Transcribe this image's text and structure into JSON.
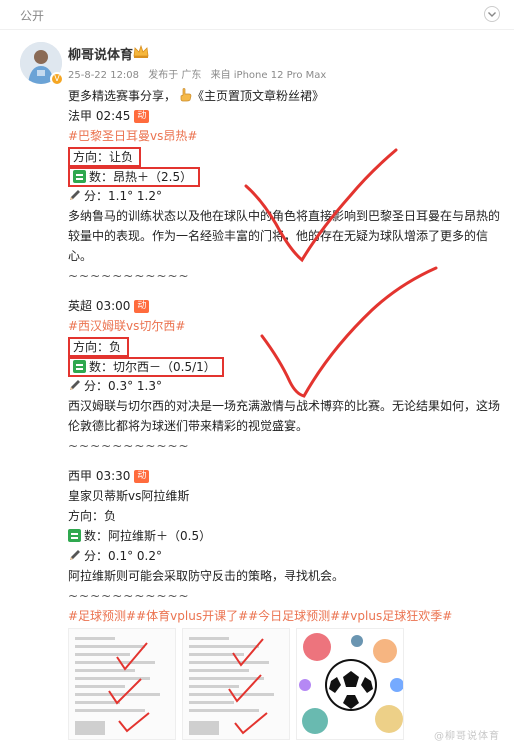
{
  "header": {
    "visibility": "公开"
  },
  "author": {
    "name": "柳哥说体育"
  },
  "meta": {
    "time": "25-8-22 12:08",
    "sent_from": "发布于 广东",
    "device": "来自 iPhone 12 Pro Max"
  },
  "intro": {
    "text": "更多精选赛事分享，",
    "link": "《主页置顶文章粉丝裙》"
  },
  "matches": [
    {
      "time": "法甲 02:45",
      "badge": "动",
      "title": "#巴黎圣日耳曼vs昂热#",
      "direction": "方向：让负",
      "numbers": "数：昂热＋（2.5）",
      "score": "分：1.1° 1.2°",
      "analysis": "多纳鲁马的训练状态以及他在球队中的角色将直接影响到巴黎圣日耳曼在与昂热的较量中的表现。作为一名经验丰富的门将，他的存在无疑为球队增添了更多的信心。",
      "divider": "~~~~~~~~~~~"
    },
    {
      "time": "英超 03:00",
      "badge": "动",
      "title": "#西汉姆联vs切尔西#",
      "direction": "方向：负",
      "numbers": "数：切尔西－（0.5/1）",
      "score": "分：0.3° 1.3°",
      "analysis": "西汉姆联与切尔西的对决是一场充满激情与战术博弈的比赛。无论结果如何，这场伦敦德比都将为球迷们带来精彩的视觉盛宴。",
      "divider": "~~~~~~~~~~~"
    },
    {
      "time": "西甲 03:30",
      "badge": "动",
      "title": "皇家贝蒂斯vs阿拉维斯",
      "direction": "方向：负",
      "numbers": "数：阿拉维斯＋（0.5）",
      "score": "分：0.1° 0.2°",
      "analysis": "阿拉维斯则可能会采取防守反击的策略，寻找机会。",
      "divider": "~~~~~~~~~~~"
    }
  ],
  "hashtags": "#足球预测##体育vplus开课了##今日足球预测##vplus足球狂欢季#",
  "watermark": "@柳哥说体育",
  "colors": {
    "topic": "#eb7350",
    "hot_badge": "#ff6b3d",
    "red_box": "#e3342f",
    "check_mark": "#e3342f",
    "number_icon": "#2fa84f"
  },
  "icons": {
    "collapse": "chevron-down-icon",
    "hand": "pointing-hand-icon",
    "numbers": "number-icon",
    "pencil": "pencil-icon",
    "crown": "crown-icon",
    "verified": "verified-icon"
  }
}
